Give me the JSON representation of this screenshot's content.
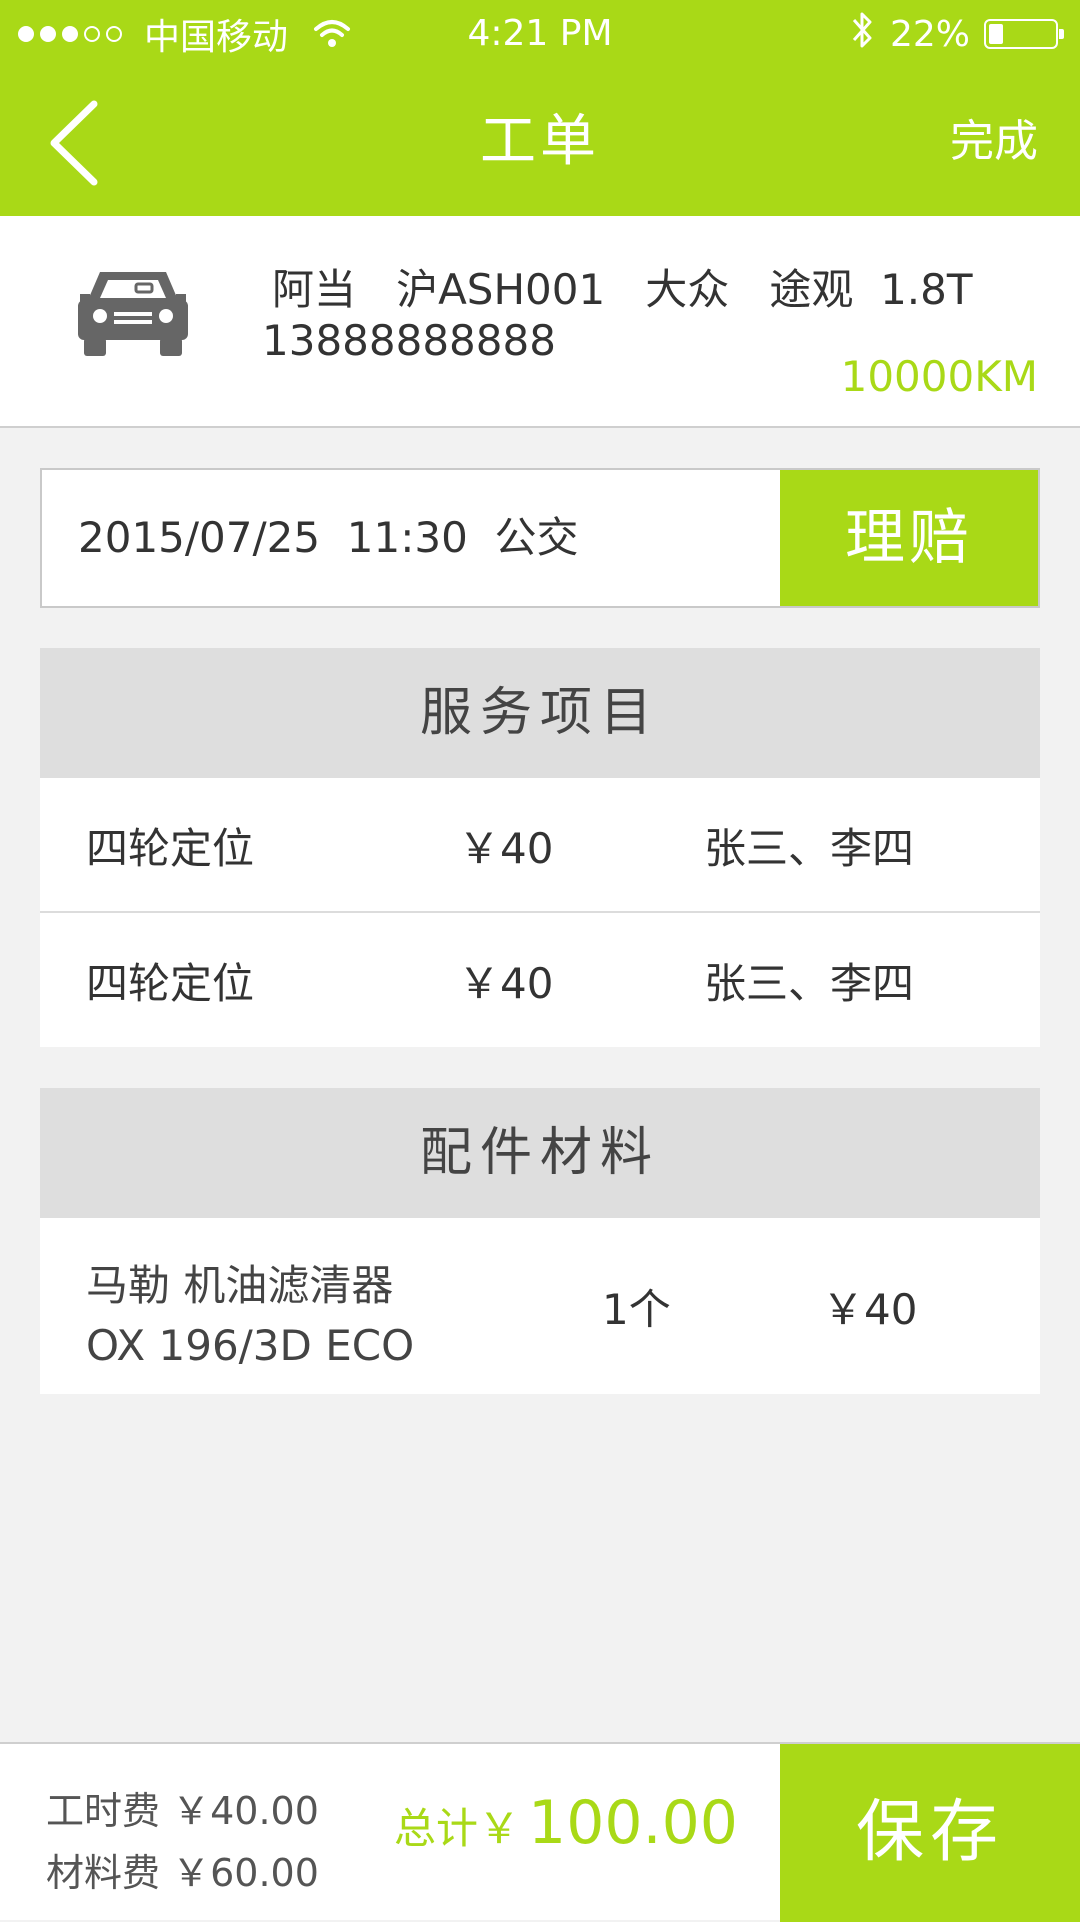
{
  "status_bar": {
    "carrier": "中国移动",
    "time": "4:21 PM",
    "battery": "22%",
    "battery_level": 0.22
  },
  "nav": {
    "title": "工单",
    "action_label": "完成",
    "back_icon": "chevron-left-icon"
  },
  "vehicle": {
    "owner": "阿当",
    "plate": "沪ASH001",
    "brand": "大众",
    "model": "途观",
    "engine": "1.8T",
    "phone": "13888888888",
    "mileage": "10000KM",
    "icon": "car-icon"
  },
  "appointment": {
    "date": "2015/07/25",
    "time": "11:30",
    "type": "公交",
    "claim_label": "理赔"
  },
  "services": {
    "title": "服务项目",
    "items": [
      {
        "name": "四轮定位",
        "price": "￥40",
        "staff": "张三、李四"
      },
      {
        "name": "四轮定位",
        "price": "￥40",
        "staff": "张三、李四"
      }
    ]
  },
  "parts": {
    "title": "配件材料",
    "items": [
      {
        "name_line1": "马勒 机油滤清器",
        "name_line2": "OX 196/3D ECO",
        "qty": "1个",
        "price": "￥40"
      }
    ]
  },
  "footer": {
    "labor_fee_label": "工时费",
    "labor_fee": "￥40.00",
    "material_fee_label": "材料费",
    "material_fee": "￥60.00",
    "total_label": "总计￥",
    "total_value": "100.00",
    "save_label": "保存"
  },
  "colors": {
    "accent": "#a9d917",
    "background": "#f2f2f2",
    "section_header": "#dedede"
  }
}
